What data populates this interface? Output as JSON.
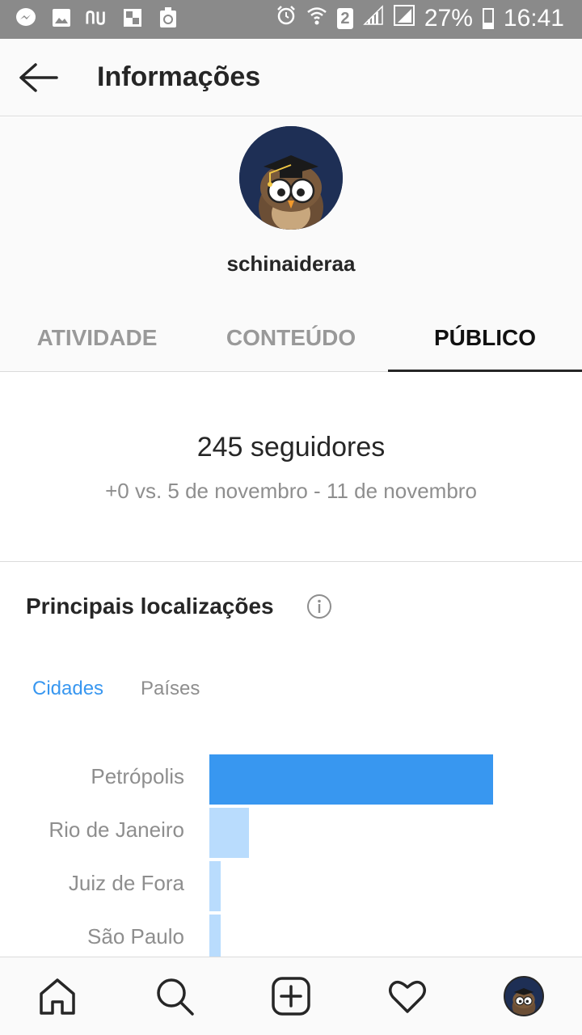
{
  "status_bar": {
    "battery": "27%",
    "time": "16:41",
    "sim_badge": "2"
  },
  "header": {
    "title": "Informações"
  },
  "profile": {
    "username": "schinaideraa"
  },
  "tabs": [
    {
      "label": "ATIVIDADE",
      "active": false
    },
    {
      "label": "CONTEÚDO",
      "active": false
    },
    {
      "label": "PÚBLICO",
      "active": true
    }
  ],
  "followers": {
    "count_text": "245 seguidores",
    "comparison_text": "+0 vs. 5 de novembro - 11 de novembro"
  },
  "locations": {
    "title": "Principais localizações",
    "subtabs": [
      {
        "label": "Cidades",
        "active": true
      },
      {
        "label": "Países",
        "active": false
      }
    ]
  },
  "chart_data": {
    "type": "bar",
    "orientation": "horizontal",
    "categories": [
      "Petrópolis",
      "Rio de Janeiro",
      "Juiz de Fora",
      "São Paulo"
    ],
    "values": [
      100,
      14,
      4,
      4
    ],
    "colors": {
      "primary": "#3897f0",
      "secondary": "#b9dcfd"
    }
  },
  "bottom_nav": [
    "home-icon",
    "search-icon",
    "add-post-icon",
    "heart-icon",
    "profile-avatar"
  ]
}
